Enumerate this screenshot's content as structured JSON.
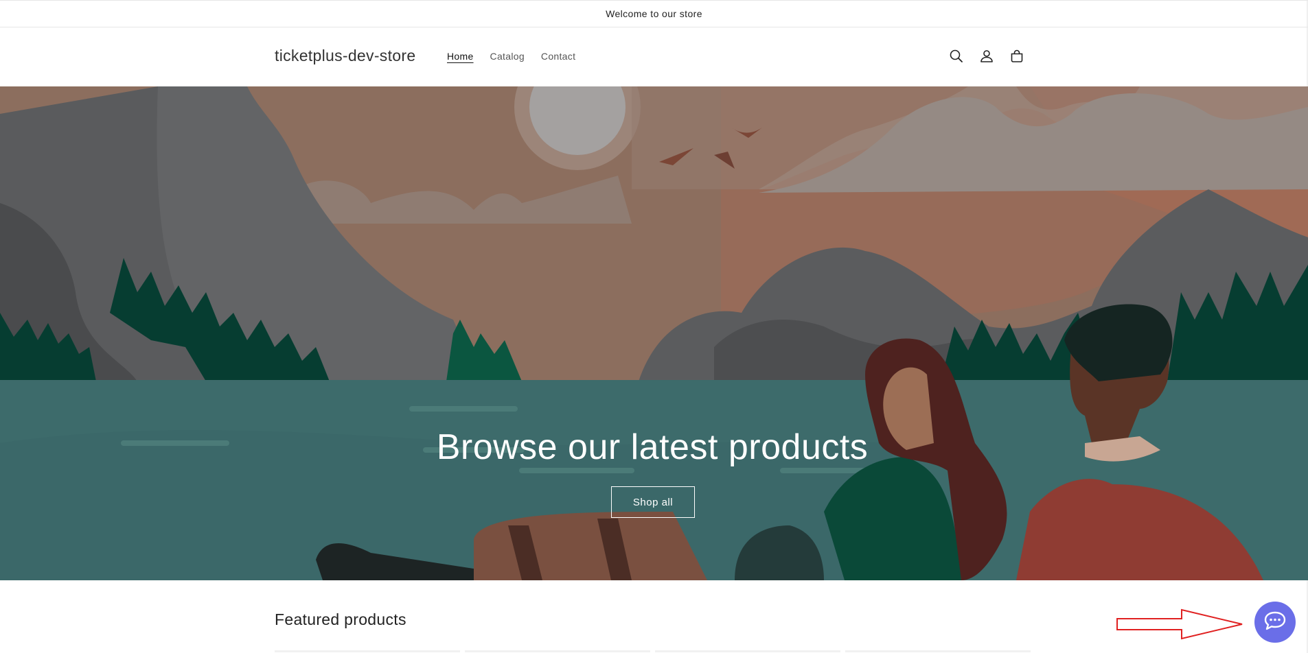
{
  "announcement": {
    "text": "Welcome to our store"
  },
  "header": {
    "logo": "ticketplus-dev-store",
    "nav": [
      {
        "label": "Home",
        "active": true
      },
      {
        "label": "Catalog",
        "active": false
      },
      {
        "label": "Contact",
        "active": false
      }
    ],
    "icons": [
      "search-icon",
      "account-icon",
      "cart-icon"
    ]
  },
  "hero": {
    "heading": "Browse our latest products",
    "button_label": "Shop all"
  },
  "featured": {
    "title": "Featured products"
  },
  "chat": {
    "icon": "chat-bubble-icon",
    "color": "#6a6ee8"
  },
  "annotation": {
    "icon": "red-arrow-icon",
    "color": "#e02020"
  }
}
